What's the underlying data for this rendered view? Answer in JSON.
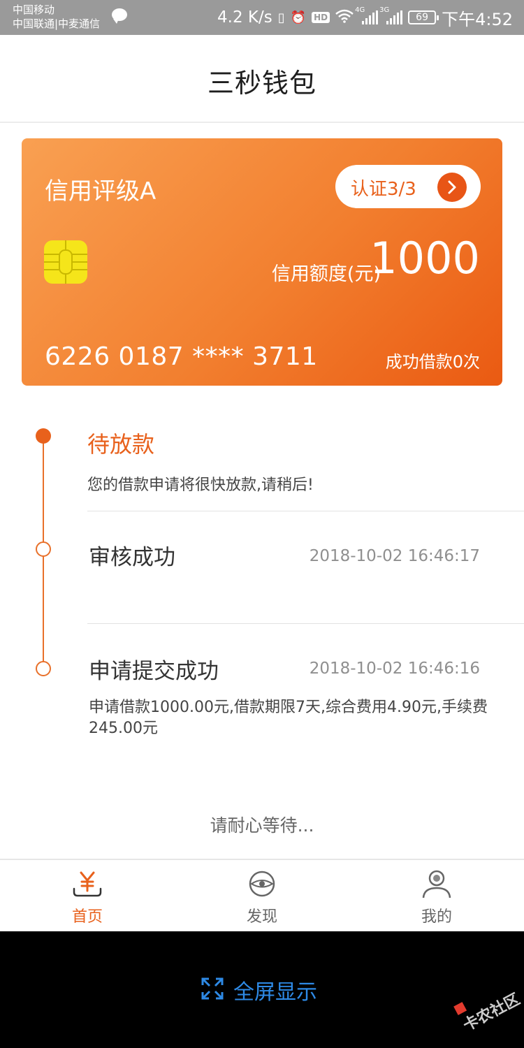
{
  "status_bar": {
    "carrier_1": "中国移动",
    "carrier_2": "中国联通|中麦通信",
    "speed": "4.2 K/s",
    "network_1": "4G",
    "network_2": "3G",
    "battery": "69",
    "time": "下午4:52"
  },
  "header": {
    "title": "三秒钱包"
  },
  "card": {
    "credit_rating": "信用评级A",
    "auth_label": "认证3/3",
    "limit_label": "信用额度(元)",
    "limit_value": "1000",
    "card_number": "6226 0187 **** 3711",
    "loan_count": "成功借款0次"
  },
  "timeline": {
    "step1": {
      "title": "待放款",
      "desc": "您的借款申请将很快放款,请稍后!"
    },
    "step2": {
      "title": "审核成功",
      "time": "2018-10-02 16:46:17"
    },
    "step3": {
      "title": "申请提交成功",
      "time": "2018-10-02 16:46:16",
      "desc": "申请借款1000.00元,借款期限7天,综合费用4.90元,手续费245.00元"
    }
  },
  "wait_text": "请耐心等待...",
  "tabs": [
    {
      "label": "首页",
      "icon": "yen-wallet-icon",
      "active": true
    },
    {
      "label": "发现",
      "icon": "eye-icon",
      "active": false
    },
    {
      "label": "我的",
      "icon": "user-icon",
      "active": false
    }
  ],
  "nav": {
    "fullscreen_label": "全屏显示",
    "watermark": "卡农社区"
  },
  "colors": {
    "accent": "#e8611c",
    "card_gradient_start": "#f9a052",
    "card_gradient_end": "#ea5a12",
    "chip": "#f5e51a",
    "fullscreen_blue": "#2e8ae6"
  }
}
